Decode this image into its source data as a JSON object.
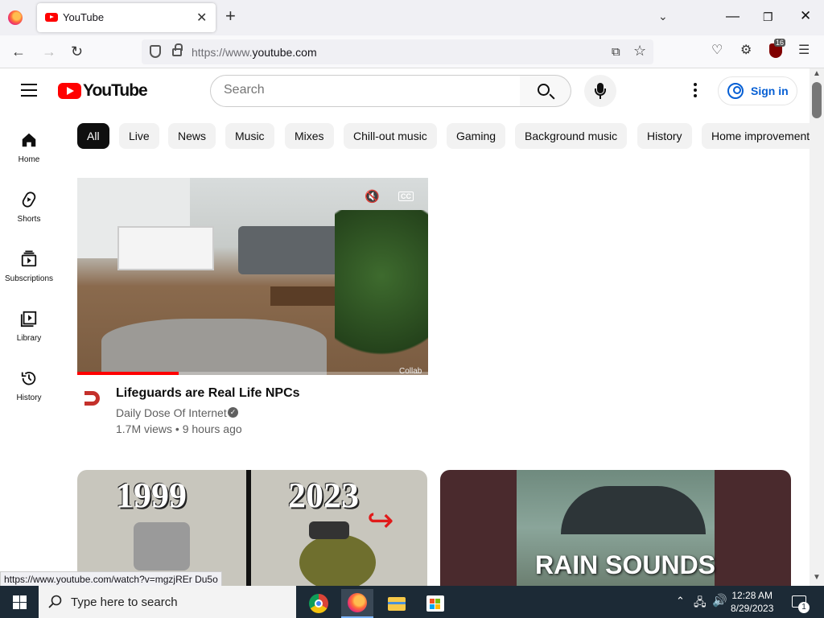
{
  "browser": {
    "tab_title": "YouTube",
    "tab_close": "✕",
    "new_tab": "+",
    "url_prefix": "https://www.",
    "url_host": "youtube.com",
    "addon_badge": "16"
  },
  "header": {
    "logo_text": "YouTube",
    "search_placeholder": "Search",
    "signin_label": "Sign in"
  },
  "guide": [
    {
      "label": "Home"
    },
    {
      "label": "Shorts"
    },
    {
      "label": "Subscriptions"
    },
    {
      "label": "Library"
    },
    {
      "label": "History"
    }
  ],
  "chips": [
    "All",
    "Live",
    "News",
    "Music",
    "Mixes",
    "Chill-out music",
    "Gaming",
    "Background music",
    "History",
    "Home improvement"
  ],
  "videos": [
    {
      "title": "Lifeguards are Real Life NPCs",
      "channel": "Daily Dose Of Internet",
      "meta": "1.7M views • 9 hours ago",
      "overlay": "Collab",
      "cc": "CC"
    },
    {
      "year_left": "1999",
      "year_right": "2023"
    },
    {
      "overlay_text": "RAIN SOUNDS"
    }
  ],
  "status_url": "https://www.youtube.com/watch?v=mgzjREr Du5o",
  "taskbar": {
    "search_placeholder": "Type here to search",
    "time": "12:28 AM",
    "date": "8/29/2023",
    "notification_count": "1"
  }
}
